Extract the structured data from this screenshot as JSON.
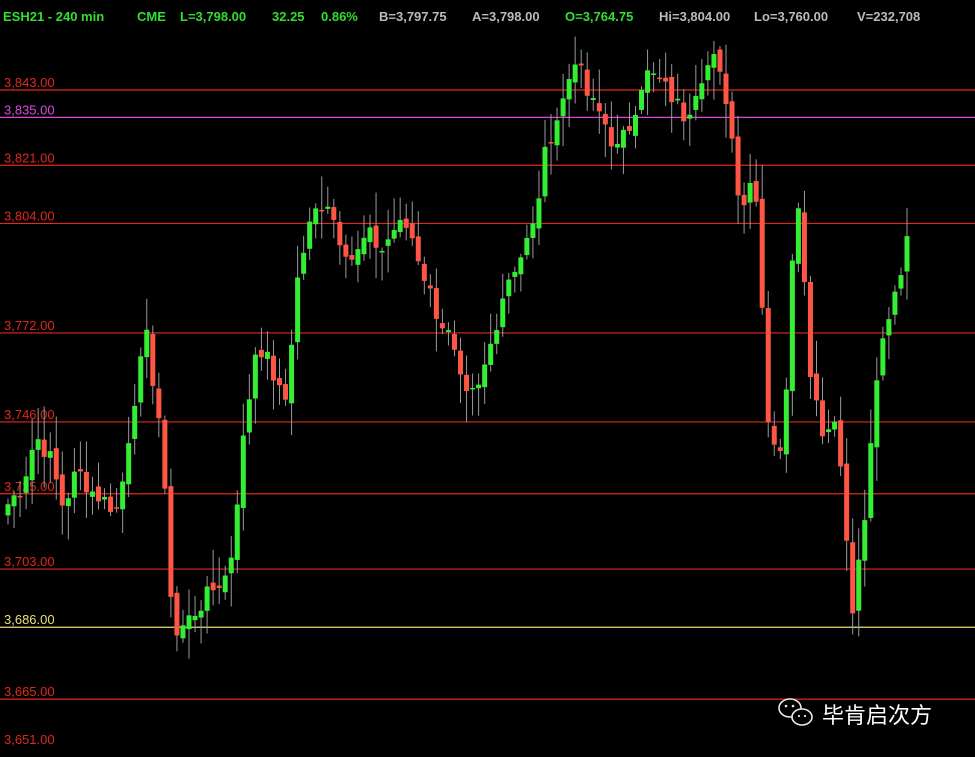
{
  "header": {
    "symbol": "ESH21 - 240 min",
    "exchange": "CME",
    "last": "L=3,798.00",
    "change": "32.25",
    "change_pct": "0.86%",
    "bid": "B=3,797.75",
    "ask": "A=3,798.00",
    "open": "O=3,764.75",
    "high": "Hi=3,804.00",
    "low": "Lo=3,760.00",
    "volume": "V=232,708"
  },
  "colors": {
    "background": "#000000",
    "up": "#33ee33",
    "down": "#ff5544",
    "header_text": "#33dd33",
    "header_gray": "#bbbbbb",
    "resistance_line": "#e0281c",
    "magenta_line": "#d84ad8",
    "yellow_line": "#e6e07a",
    "wick": "#9a9a9a"
  },
  "watermark": {
    "text": "毕肯启次方",
    "icon": "wechat-icon"
  },
  "chart_data": {
    "type": "candlestick",
    "ylim": [
      3651,
      3864
    ],
    "levels": [
      {
        "value": 3843.0,
        "label": "3,843.00",
        "color": "red"
      },
      {
        "value": 3835.0,
        "label": "3,835.00",
        "color": "magenta"
      },
      {
        "value": 3821.0,
        "label": "3,821.00",
        "color": "red"
      },
      {
        "value": 3804.0,
        "label": "3,804.00",
        "color": "red"
      },
      {
        "value": 3772.0,
        "label": "3,772.00",
        "color": "red"
      },
      {
        "value": 3746.0,
        "label": "3,746.00",
        "color": "red"
      },
      {
        "value": 3725.0,
        "label": "3,725.00",
        "color": "red"
      },
      {
        "value": 3703.0,
        "label": "3,703.00",
        "color": "red"
      },
      {
        "value": 3686.0,
        "label": "3,686.00",
        "color": "yellow"
      },
      {
        "value": 3665.0,
        "label": "3,665.00",
        "color": "red"
      },
      {
        "value": 3651.0,
        "label": "3,651.00",
        "color": "none"
      }
    ],
    "anchors": [
      3722,
      3727,
      3742,
      3736,
      3721,
      3732,
      3726,
      3723,
      3720,
      3750,
      3771,
      3745,
      3683,
      3688,
      3693,
      3698,
      3702,
      3740,
      3770,
      3762,
      3750,
      3790,
      3806,
      3812,
      3800,
      3793,
      3801,
      3796,
      3803,
      3803,
      3790,
      3778,
      3770,
      3752,
      3755,
      3770,
      3787,
      3794,
      3803,
      3828,
      3838,
      3853,
      3840,
      3835,
      3825,
      3833,
      3848,
      3846,
      3841,
      3835,
      3847,
      3852,
      3840,
      3808,
      3820,
      3745,
      3734,
      3820,
      3762,
      3742,
      3748,
      3688,
      3720,
      3765,
      3783,
      3798
    ]
  }
}
